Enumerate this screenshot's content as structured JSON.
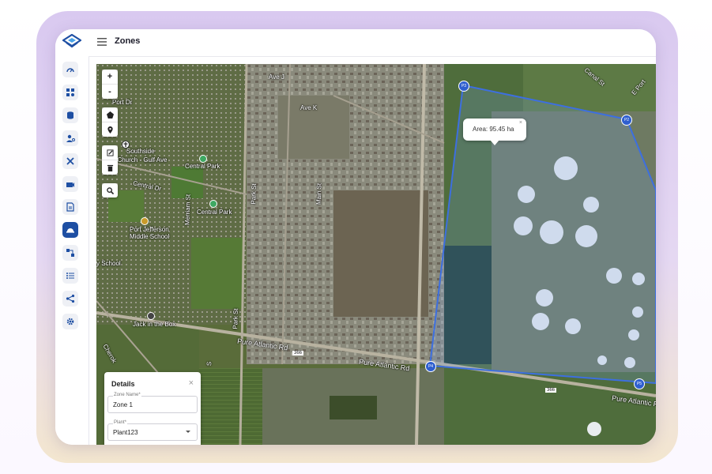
{
  "header": {
    "title": "Zones"
  },
  "sidebar": {
    "items": [
      {
        "id": "dashboard",
        "icon": "speedometer-icon"
      },
      {
        "id": "widgets",
        "icon": "grid-icon"
      },
      {
        "id": "cylinder",
        "icon": "database-icon"
      },
      {
        "id": "users",
        "icon": "user-settings-icon"
      },
      {
        "id": "tools",
        "icon": "tools-icon"
      },
      {
        "id": "camera",
        "icon": "camera-icon"
      },
      {
        "id": "documents",
        "icon": "document-icon"
      },
      {
        "id": "zones",
        "icon": "zone-helmet-icon",
        "active": true
      },
      {
        "id": "workflow",
        "icon": "flow-icon"
      },
      {
        "id": "list",
        "icon": "list-icon"
      },
      {
        "id": "share",
        "icon": "share-icon"
      },
      {
        "id": "settings",
        "icon": "gear-icon"
      }
    ],
    "accent_color": "#1e4fa3"
  },
  "map": {
    "zoom_in": "+",
    "zoom_out": "-",
    "tooltip": {
      "text": "Area: 95.45 ha",
      "close": "×"
    },
    "vertices": [
      "P3",
      "P2",
      "P4",
      "P5"
    ],
    "polygon_color": "#3d6fe0",
    "labels": {
      "ave_j": "Ave J",
      "ave_k": "Ave K",
      "port_dr": "Port Dr",
      "canal_st": "Canal St",
      "e_port": "E Port",
      "southside_church_1": "Southside",
      "southside_church_2": "tist Church - Gulf Ave",
      "central_dr": "Central Dr",
      "central_park_1": "Central Park",
      "central_park_2": "Central Park",
      "merriam_st": "Merriam St",
      "park_st": "Park St",
      "main_st": "Main St",
      "school_1": "Port Jefferson",
      "school_2": "Middle School",
      "school_3": "y School",
      "park_st_2": "Park St",
      "jack_box": "Jack in the Box",
      "pure_atlantic_1": "Pure Atlantic Rd",
      "pure_atlantic_2": "Pure Atlantic Rd",
      "pure_atlantic_3": "Pure Atlantic Rd",
      "shield_366_1": "366",
      "shield_366_2": "366",
      "cherokee": "Cherok",
      "sun": "S"
    }
  },
  "details": {
    "title": "Details",
    "close": "×",
    "zone_name_label": "Zone Name*",
    "zone_name_value": "Zone 1",
    "plant_label": "Plant*",
    "plant_value": "Plant123"
  }
}
